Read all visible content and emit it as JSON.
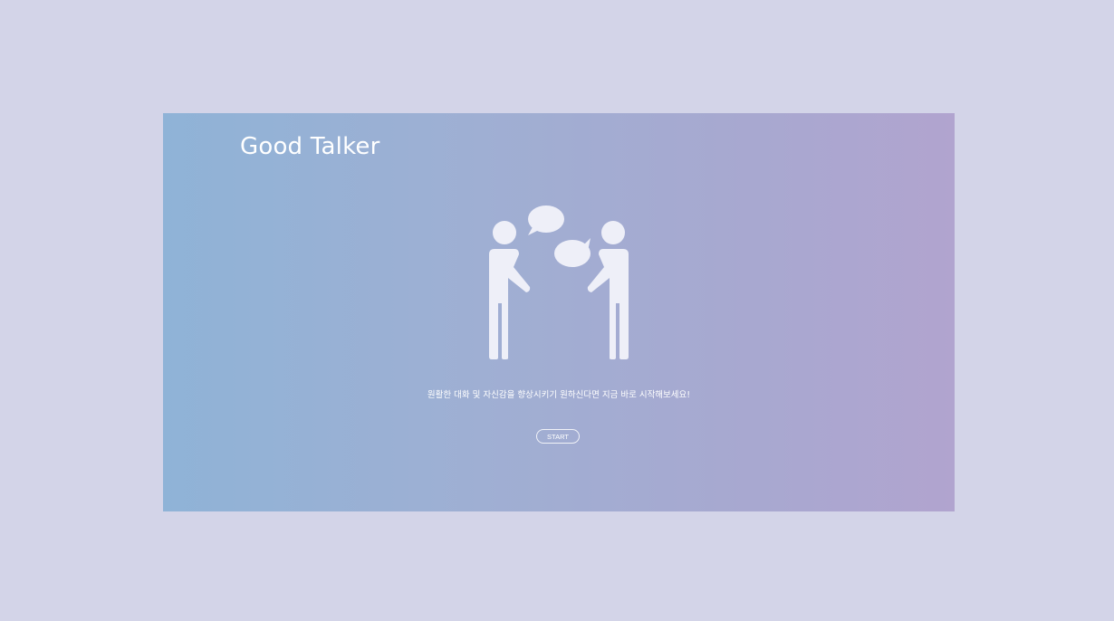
{
  "app": {
    "title": "Good Talker"
  },
  "main": {
    "tagline": "원활한 대화 및 자신감을 향상시키기 원하신다면 지금 바로 시작해보세요!",
    "start_label": "START",
    "illustration_icon": "two-people-talking-icon"
  },
  "colors": {
    "page_background": "#d3d4e8",
    "gradient_left": "#8fb3d7",
    "gradient_right": "#b1a4cf",
    "foreground": "#ffffff",
    "figure_fill": "#eeeff8"
  }
}
